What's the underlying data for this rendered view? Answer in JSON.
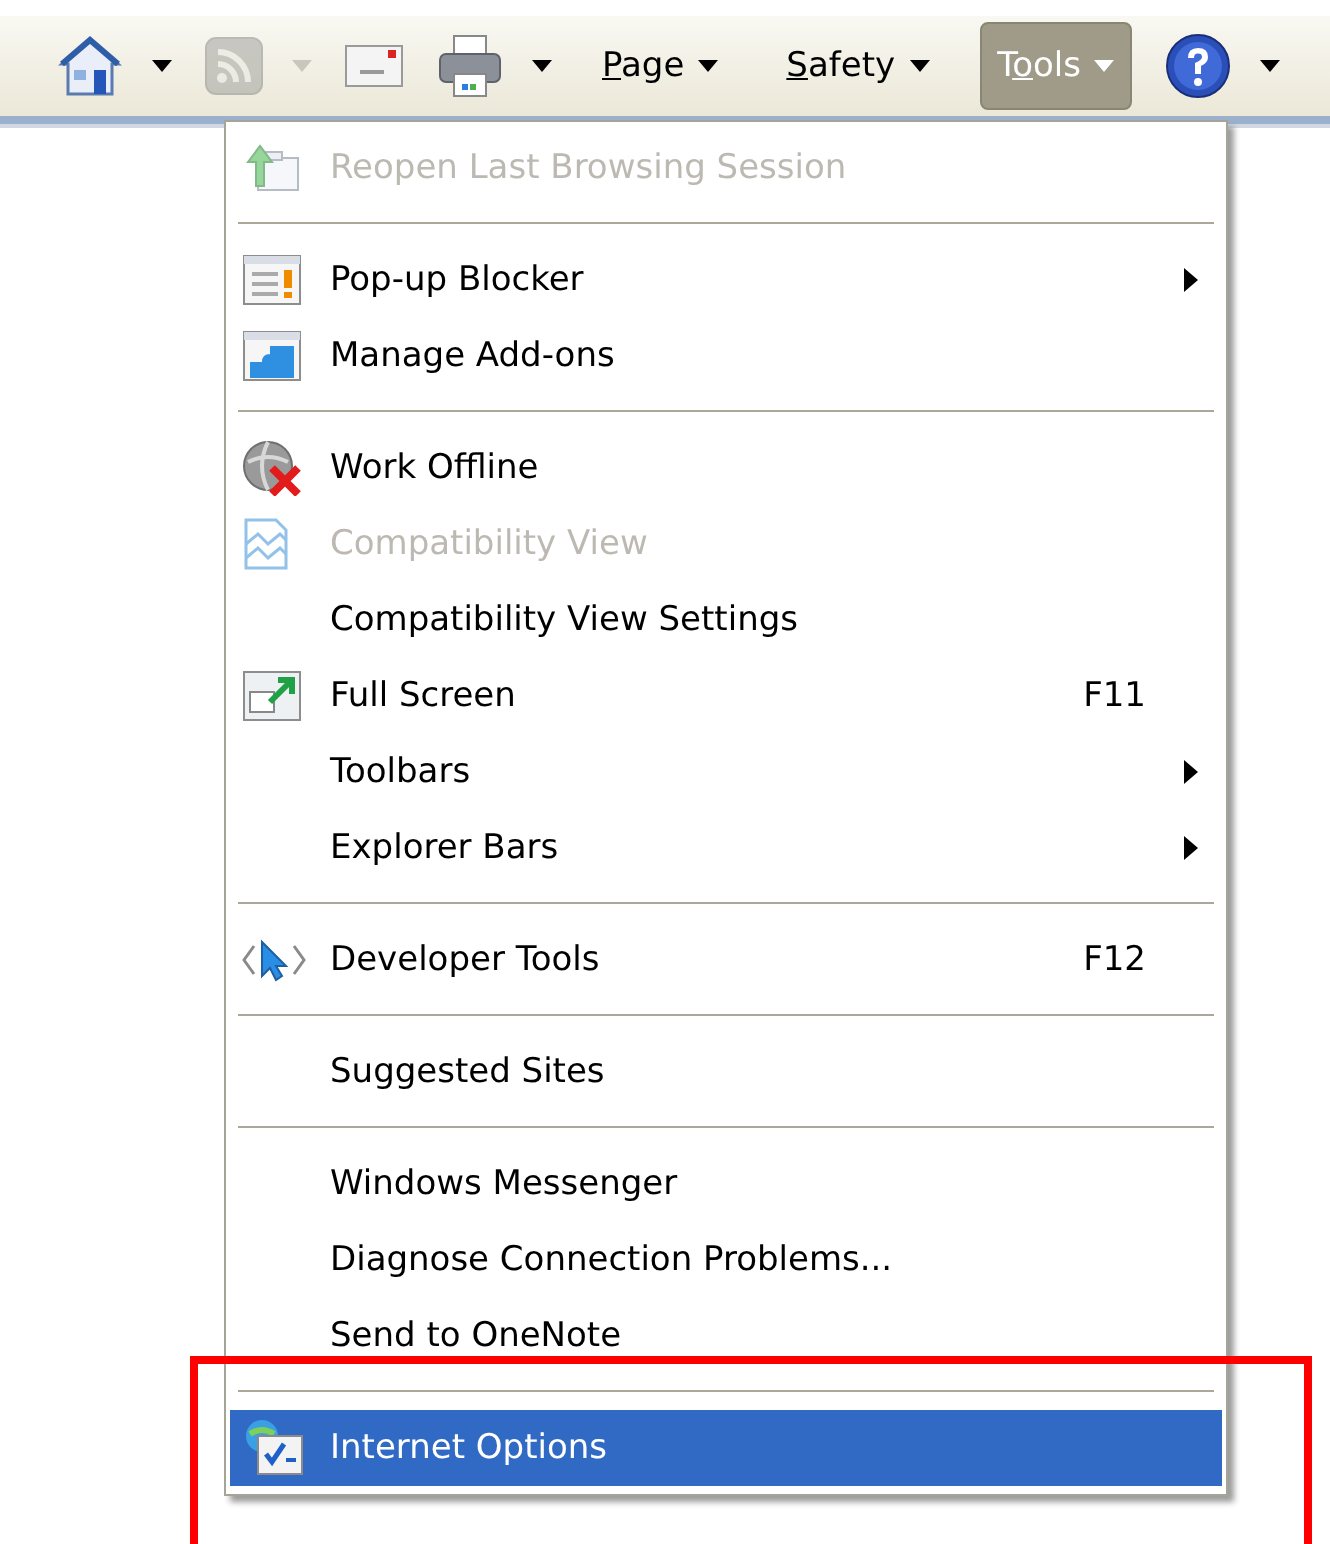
{
  "toolbar": [
    {
      "kind": "icon",
      "disabled": false,
      "dropdown": true
    },
    {
      "kind": "icon",
      "disabled": true,
      "dropdown": true
    },
    {
      "kind": "icon",
      "disabled": false,
      "dropdown": false
    },
    {
      "kind": "icon",
      "disabled": false,
      "dropdown": true
    },
    {
      "kind": "menu",
      "key": "P",
      "after": "age",
      "selected": false
    },
    {
      "kind": "menu",
      "key": "S",
      "after": "afety",
      "selected": false
    },
    {
      "kind": "menu",
      "before": "T",
      "key": "o",
      "after": "ols",
      "selected": true
    },
    {
      "kind": "icon",
      "disabled": false,
      "dropdown": true
    }
  ],
  "menu": [
    {
      "kind": "item",
      "label": "Reopen Last Browsing Session",
      "disabled": true,
      "submenu": false,
      "selected": false
    },
    {
      "kind": "separator"
    },
    {
      "kind": "item",
      "label": "Pop-up Blocker",
      "disabled": false,
      "submenu": true,
      "selected": false
    },
    {
      "kind": "item",
      "label": "Manage Add-ons",
      "disabled": false,
      "submenu": false,
      "selected": false
    },
    {
      "kind": "separator"
    },
    {
      "kind": "item",
      "label": "Work Offline",
      "disabled": false,
      "submenu": false,
      "selected": false
    },
    {
      "kind": "item",
      "label": "Compatibility View",
      "disabled": true,
      "submenu": false,
      "selected": false
    },
    {
      "kind": "item",
      "label": "Compatibility View Settings",
      "disabled": false,
      "submenu": false,
      "selected": false
    },
    {
      "kind": "item",
      "label": "Full Screen",
      "shortcut": "F11",
      "disabled": false,
      "submenu": false,
      "selected": false
    },
    {
      "kind": "item",
      "label": "Toolbars",
      "disabled": false,
      "submenu": true,
      "selected": false
    },
    {
      "kind": "item",
      "label": "Explorer Bars",
      "disabled": false,
      "submenu": true,
      "selected": false
    },
    {
      "kind": "separator"
    },
    {
      "kind": "item",
      "label": "Developer Tools",
      "shortcut": "F12",
      "disabled": false,
      "submenu": false,
      "selected": false
    },
    {
      "kind": "separator"
    },
    {
      "kind": "item",
      "label": "Suggested Sites",
      "disabled": false,
      "submenu": false,
      "selected": false
    },
    {
      "kind": "separator"
    },
    {
      "kind": "item",
      "label": "Windows Messenger",
      "disabled": false,
      "submenu": false,
      "selected": false
    },
    {
      "kind": "item",
      "label": "Diagnose Connection Problems...",
      "disabled": false,
      "submenu": false,
      "selected": false
    },
    {
      "kind": "item",
      "label": "Send to OneNote",
      "disabled": false,
      "submenu": false,
      "selected": false
    },
    {
      "kind": "separator"
    },
    {
      "kind": "item",
      "label": "Internet Options",
      "disabled": false,
      "submenu": false,
      "selected": true
    }
  ],
  "highlight_box": true
}
